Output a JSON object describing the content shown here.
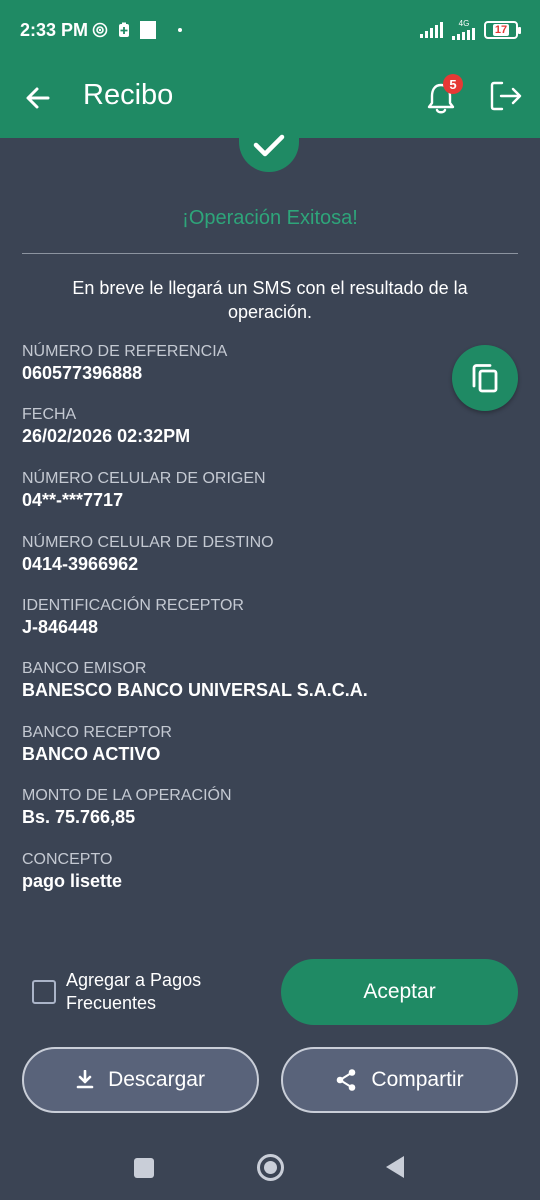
{
  "status_bar": {
    "time": "2:33 PM",
    "network_label": "4G",
    "battery": "17"
  },
  "app_bar": {
    "title": "Recibo",
    "notification_count": "5"
  },
  "success": {
    "title": "¡Operación Exitosa!",
    "note": "En breve le llegará un SMS con el resultado de la operación."
  },
  "fields": [
    {
      "label": "NÚMERO DE REFERENCIA",
      "value": "060577396888"
    },
    {
      "label": "FECHA",
      "value": "26/02/2026 02:32PM"
    },
    {
      "label": "NÚMERO CELULAR DE ORIGEN",
      "value": "04**-***7717"
    },
    {
      "label": "NÚMERO CELULAR DE DESTINO",
      "value": "0414-3966962"
    },
    {
      "label": "IDENTIFICACIÓN RECEPTOR",
      "value": "J-846448"
    },
    {
      "label": "BANCO EMISOR",
      "value": "BANESCO BANCO UNIVERSAL S.A.C.A."
    },
    {
      "label": "BANCO RECEPTOR",
      "value": "BANCO ACTIVO"
    },
    {
      "label": "MONTO DE LA OPERACIÓN",
      "value": "Bs. 75.766,85"
    },
    {
      "label": "CONCEPTO",
      "value": "pago lisette"
    }
  ],
  "actions": {
    "frequent_payments_checkbox_label_line1": "Agregar a Pagos",
    "frequent_payments_checkbox_label_line2": "Frecuentes",
    "frequent_payments_checked": false,
    "accept_label": "Aceptar",
    "download_label": "Descargar",
    "share_label": "Compartir"
  },
  "icons": {
    "back": "arrow-left-icon",
    "notifications": "bell-icon",
    "logout": "logout-icon",
    "success": "check-icon",
    "copy": "copy-icon",
    "download": "download-icon",
    "share": "share-icon"
  },
  "colors": {
    "primary": "#1f8a64",
    "background": "#3b4454",
    "success_text": "#2ea57a",
    "badge": "#e53935"
  }
}
